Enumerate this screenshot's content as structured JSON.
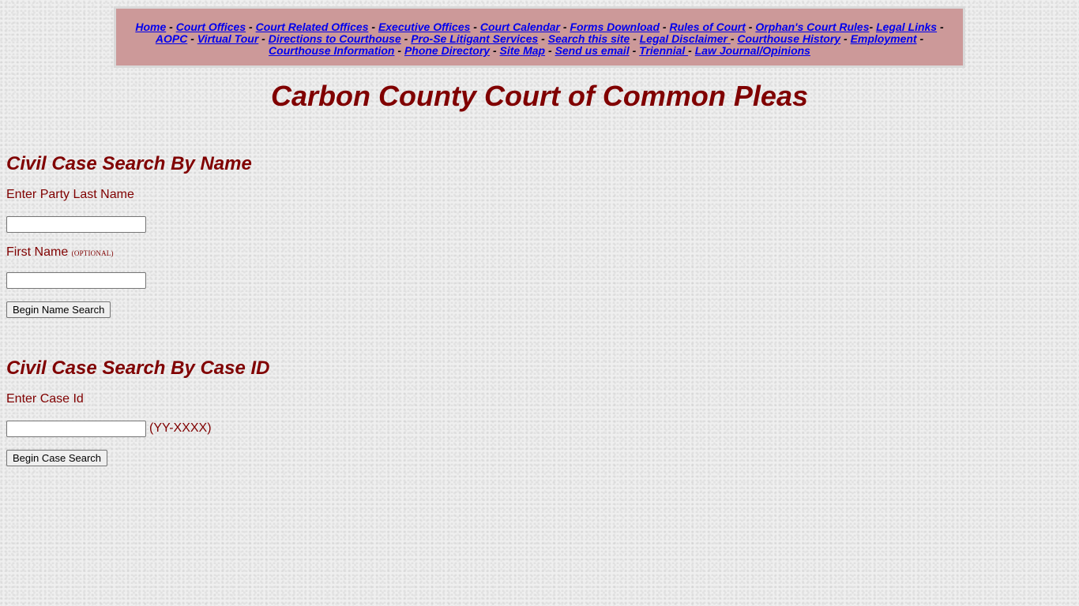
{
  "nav": {
    "links": [
      {
        "label": "Home",
        "sep": " - "
      },
      {
        "label": "Court Offices",
        "sep": " - "
      },
      {
        "label": "Court Related Offices",
        "sep": " - "
      },
      {
        "label": "Executive Offices",
        "sep": " - "
      },
      {
        "label": "Court Calendar",
        "sep": " - "
      },
      {
        "label": "Forms Download",
        "sep": " - "
      },
      {
        "label": "Rules of Court",
        "sep": " - "
      },
      {
        "label": "Orphan's Court Rules",
        "sep": "- "
      },
      {
        "label": "Legal Links",
        "sep": " - "
      },
      {
        "label": "AOPC",
        "sep": " - "
      },
      {
        "label": "Virtual Tour",
        "sep": " - "
      },
      {
        "label": "Directions to Courthouse",
        "sep": " - "
      },
      {
        "label": "Pro-Se Litigant Services",
        "sep": " - "
      },
      {
        "label": "Search this site",
        "sep": " - "
      },
      {
        "label": "Legal Disclaimer ",
        "sep": "- "
      },
      {
        "label": "Courthouse History",
        "sep": " - "
      },
      {
        "label": "Employment",
        "sep": " - "
      },
      {
        "label": "Courthouse Information",
        "sep": " - "
      },
      {
        "label": "Phone Directory",
        "sep": " - "
      },
      {
        "label": "Site Map",
        "sep": " - "
      },
      {
        "label": "Send us email",
        "sep": " - "
      },
      {
        "label": "Triennial ",
        "sep": "- "
      },
      {
        "label": "Law Journal/Opinions",
        "sep": ""
      }
    ]
  },
  "page": {
    "title": "Carbon County Court of Common Pleas"
  },
  "name_search": {
    "heading": "Civil Case Search By Name",
    "last_name_label": "Enter Party Last Name",
    "last_name_value": "",
    "first_name_label": "First Name ",
    "first_name_optional": "(OPTIONAL)",
    "first_name_value": "",
    "button_label": "Begin Name Search"
  },
  "case_search": {
    "heading": "Civil Case Search By Case ID",
    "case_id_label": "Enter Case Id",
    "case_id_value": "",
    "format_hint": "(YY-XXXX)",
    "button_label": "Begin Case Search"
  },
  "colors": {
    "text_primary": "#800000",
    "nav_background": "#cc9999",
    "link": "#0000ee"
  }
}
